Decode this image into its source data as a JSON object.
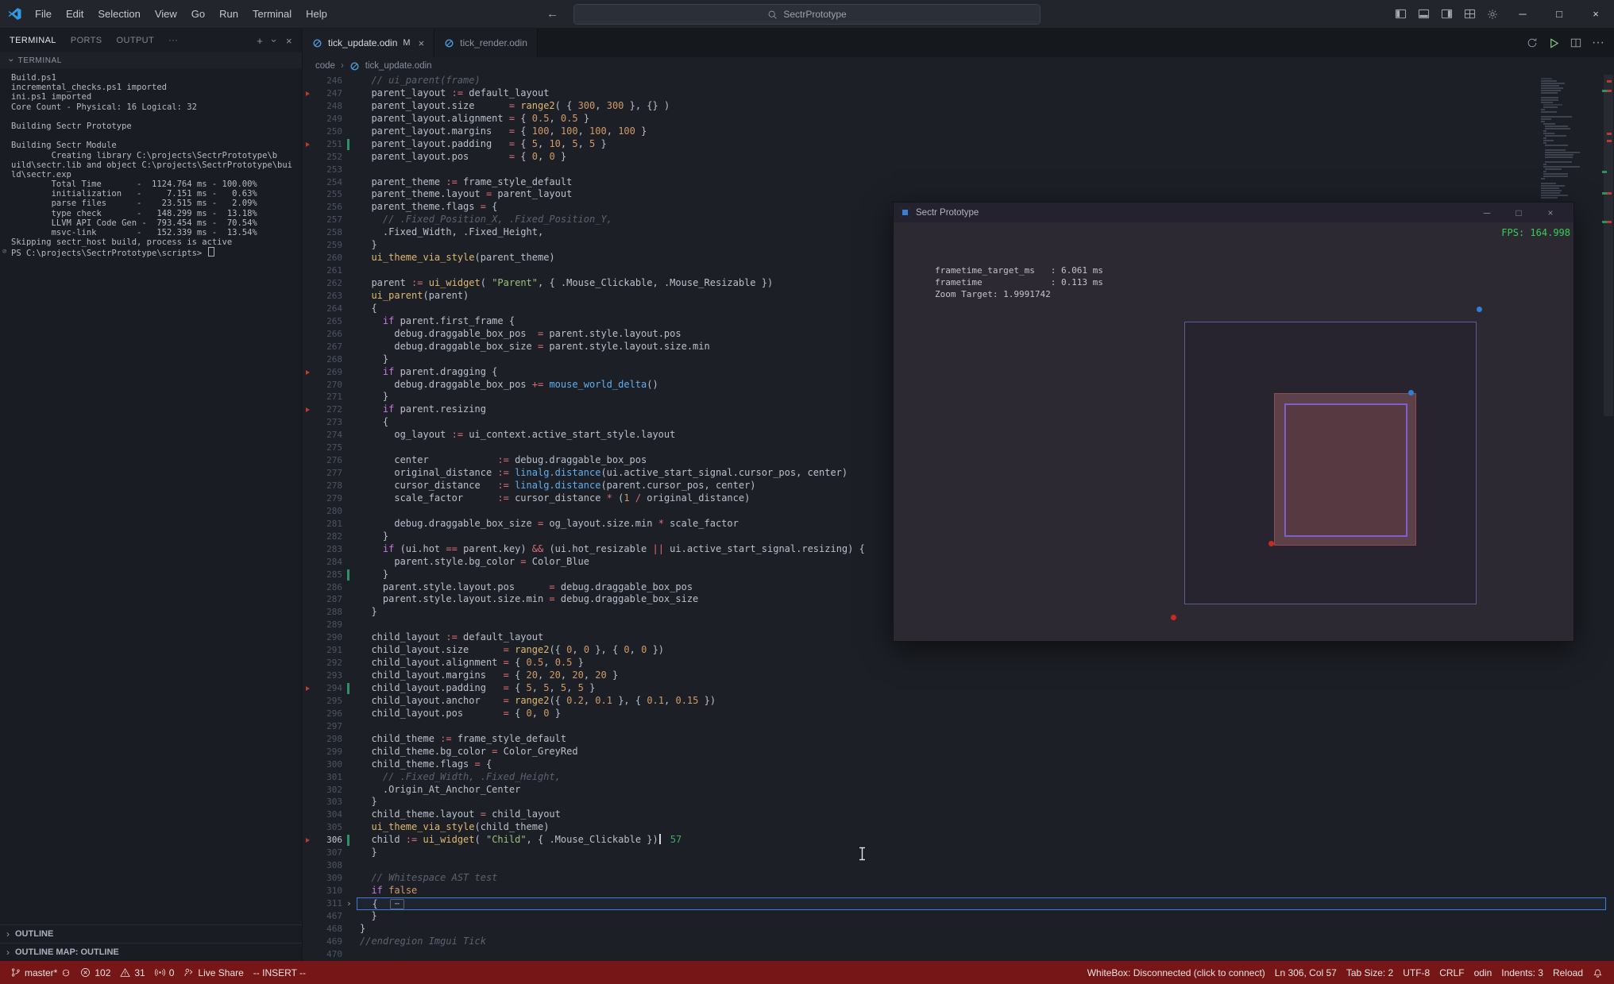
{
  "titlebar": {
    "menus": [
      "File",
      "Edit",
      "Selection",
      "View",
      "Go",
      "Run",
      "Terminal",
      "Help"
    ],
    "search": "SectrPrototype"
  },
  "panel": {
    "tabs": [
      "TERMINAL",
      "PORTS",
      "OUTPUT"
    ],
    "head_label": "TERMINAL"
  },
  "terminal": {
    "lines": [
      "Build.ps1",
      "incremental_checks.ps1 imported",
      "ini.ps1 imported",
      "Core Count - Physical: 16 Logical: 32",
      "",
      "Building Sectr Prototype",
      "",
      "Building Sectr Module",
      "        Creating library C:\\projects\\SectrPrototype\\b",
      "uild\\sectr.lib and object C:\\projects\\SectrPrototype\\bui",
      "ld\\sectr.exp",
      "        Total Time       -  1124.764 ms - 100.00%",
      "        initialization   -     7.151 ms -   0.63%",
      "        parse files      -    23.515 ms -   2.09%",
      "        type check       -   148.299 ms -  13.18%",
      "        LLVM API Code Gen -  793.454 ms -  70.54%",
      "        msvc-link        -   152.339 ms -  13.54%",
      "Skipping sectr_host build, process is active",
      "PS C:\\projects\\SectrPrototype\\scripts> "
    ]
  },
  "sidebar_sections": [
    "OUTLINE",
    "OUTLINE MAP: OUTLINE"
  ],
  "editor": {
    "tabs": [
      {
        "label": "tick_update.odin",
        "badge": "M",
        "active": true
      },
      {
        "label": "tick_render.odin",
        "badge": "",
        "active": false
      }
    ],
    "breadcrumb": [
      "code",
      "tick_update.odin"
    ],
    "hint": "57",
    "fold_glyph": "⋯",
    "lines": [
      {
        "n": 246,
        "t": "  // ui_parent(frame)"
      },
      {
        "n": 247,
        "m": 1,
        "t": "  parent_layout := default_layout"
      },
      {
        "n": 248,
        "t": "  parent_layout.size      = range2( { 300, 300 }, {} )"
      },
      {
        "n": 249,
        "t": "  parent_layout.alignment = { 0.5, 0.5 }"
      },
      {
        "n": 250,
        "t": "  parent_layout.margins   = { 100, 100, 100, 100 }"
      },
      {
        "n": 251,
        "m": 1,
        "c": 1,
        "t": "  parent_layout.padding   = { 5, 10, 5, 5 }"
      },
      {
        "n": 252,
        "t": "  parent_layout.pos       = { 0, 0 }"
      },
      {
        "n": 253,
        "t": ""
      },
      {
        "n": 254,
        "t": "  parent_theme := frame_style_default"
      },
      {
        "n": 255,
        "t": "  parent_theme.layout = parent_layout"
      },
      {
        "n": 256,
        "t": "  parent_theme.flags = {"
      },
      {
        "n": 257,
        "t": "    // .Fixed_Position_X, .Fixed_Position_Y,"
      },
      {
        "n": 258,
        "t": "    .Fixed_Width, .Fixed_Height,"
      },
      {
        "n": 259,
        "t": "  }"
      },
      {
        "n": 260,
        "t": "  ui_theme_via_style(parent_theme)"
      },
      {
        "n": 261,
        "t": ""
      },
      {
        "n": 262,
        "t": "  parent := ui_widget( \"Parent\", { .Mouse_Clickable, .Mouse_Resizable })"
      },
      {
        "n": 263,
        "t": "  ui_parent(parent)"
      },
      {
        "n": 264,
        "t": "  {"
      },
      {
        "n": 265,
        "t": "    if parent.first_frame {"
      },
      {
        "n": 266,
        "t": "      debug.draggable_box_pos  = parent.style.layout.pos"
      },
      {
        "n": 267,
        "t": "      debug.draggable_box_size = parent.style.layout.size.min"
      },
      {
        "n": 268,
        "t": "    }"
      },
      {
        "n": 269,
        "m": 1,
        "t": "    if parent.dragging {"
      },
      {
        "n": 270,
        "t": "      debug.draggable_box_pos += mouse_world_delta()"
      },
      {
        "n": 271,
        "t": "    }"
      },
      {
        "n": 272,
        "m": 1,
        "t": "    if parent.resizing"
      },
      {
        "n": 273,
        "t": "    {"
      },
      {
        "n": 274,
        "t": "      og_layout := ui_context.active_start_style.layout"
      },
      {
        "n": 275,
        "t": ""
      },
      {
        "n": 276,
        "t": "      center            := debug.draggable_box_pos"
      },
      {
        "n": 277,
        "t": "      original_distance := linalg.distance(ui.active_start_signal.cursor_pos, center)"
      },
      {
        "n": 278,
        "t": "      cursor_distance   := linalg.distance(parent.cursor_pos, center)"
      },
      {
        "n": 279,
        "t": "      scale_factor      := cursor_distance * (1 / original_distance)"
      },
      {
        "n": 280,
        "t": ""
      },
      {
        "n": 281,
        "t": "      debug.draggable_box_size = og_layout.size.min * scale_factor"
      },
      {
        "n": 282,
        "t": "    }"
      },
      {
        "n": 283,
        "t": "    if (ui.hot == parent.key) && (ui.hot_resizable || ui.active_start_signal.resizing) {"
      },
      {
        "n": 284,
        "t": "      parent.style.bg_color = Color_Blue"
      },
      {
        "n": 285,
        "c": 1,
        "t": "    }"
      },
      {
        "n": 286,
        "t": "    parent.style.layout.pos      = debug.draggable_box_pos"
      },
      {
        "n": 287,
        "t": "    parent.style.layout.size.min = debug.draggable_box_size"
      },
      {
        "n": 288,
        "t": "  }"
      },
      {
        "n": 289,
        "t": ""
      },
      {
        "n": 290,
        "t": "  child_layout := default_layout"
      },
      {
        "n": 291,
        "t": "  child_layout.size      = range2({ 0, 0 }, { 0, 0 })"
      },
      {
        "n": 292,
        "t": "  child_layout.alignment = { 0.5, 0.5 }"
      },
      {
        "n": 293,
        "t": "  child_layout.margins   = { 20, 20, 20, 20 }"
      },
      {
        "n": 294,
        "m": 1,
        "c": 1,
        "t": "  child_layout.padding   = { 5, 5, 5, 5 }"
      },
      {
        "n": 295,
        "t": "  child_layout.anchor    = range2({ 0.2, 0.1 }, { 0.1, 0.15 })"
      },
      {
        "n": 296,
        "t": "  child_layout.pos       = { 0, 0 }"
      },
      {
        "n": 297,
        "t": ""
      },
      {
        "n": 298,
        "t": "  child_theme := frame_style_default"
      },
      {
        "n": 299,
        "t": "  child_theme.bg_color = Color_GreyRed"
      },
      {
        "n": 300,
        "t": "  child_theme.flags = {"
      },
      {
        "n": 301,
        "t": "    // .Fixed_Width, .Fixed_Height,"
      },
      {
        "n": 302,
        "t": "    .Origin_At_Anchor_Center"
      },
      {
        "n": 303,
        "t": "  }"
      },
      {
        "n": 304,
        "t": "  child_theme.layout = child_layout"
      },
      {
        "n": 305,
        "t": "  ui_theme_via_style(child_theme)"
      },
      {
        "n": 306,
        "m": 1,
        "c": 1,
        "cur": 1,
        "t": "  child := ui_widget( \"Child\", { .Mouse_Clickable })"
      },
      {
        "n": 307,
        "t": "  }"
      },
      {
        "n": 308,
        "t": ""
      },
      {
        "n": 309,
        "t": "  // Whitespace AST test"
      },
      {
        "n": 310,
        "t": "  if false"
      },
      {
        "n": 311,
        "fold": 1,
        "t": "  { "
      },
      {
        "n": 467,
        "t": "  }"
      },
      {
        "n": 468,
        "t": "}"
      },
      {
        "n": 469,
        "t": "//endregion Imgui Tick"
      },
      {
        "n": 470,
        "t": ""
      }
    ]
  },
  "overlay": {
    "title": "Sectr Prototype",
    "fps": "FPS: 164.998",
    "stats": [
      "frametime_target_ms   : 6.061 ms",
      "frametime             : 0.113 ms",
      "Zoom Target: 1.9991742"
    ]
  },
  "statusbar": {
    "left": [
      {
        "name": "git-branch-status",
        "icon": "branch",
        "label": "master*",
        "icon2": "sync"
      },
      {
        "name": "problems-errors",
        "icon": "error",
        "label": "102"
      },
      {
        "name": "problems-warnings",
        "icon": "warn",
        "label": "31"
      },
      {
        "name": "ports-status",
        "icon": "radio",
        "label": "0"
      },
      {
        "name": "live-share",
        "icon": "share",
        "label": "Live Share"
      },
      {
        "name": "vim-mode",
        "label": "-- INSERT --"
      }
    ],
    "right": [
      {
        "name": "whitebox-status",
        "label": "WhiteBox: Disconnected (click to connect)"
      },
      {
        "name": "cursor-position",
        "label": "Ln 306, Col 57"
      },
      {
        "name": "tab-size",
        "label": "Tab Size: 2"
      },
      {
        "name": "encoding",
        "label": "UTF-8"
      },
      {
        "name": "eol-sequence",
        "label": "CRLF"
      },
      {
        "name": "language-mode",
        "label": "odin"
      },
      {
        "name": "indents-info",
        "label": "Indents: 3"
      },
      {
        "name": "reload",
        "label": "Reload"
      },
      {
        "name": "notifications-bell",
        "icon": "bell",
        "label": ""
      }
    ]
  }
}
